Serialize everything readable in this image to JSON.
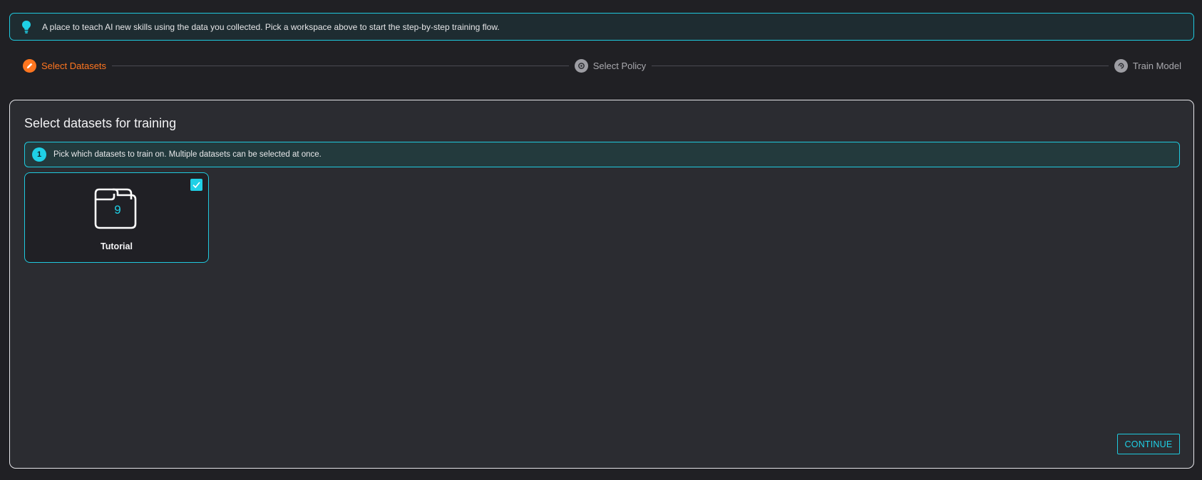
{
  "info_banner": {
    "icon": "lightbulb-icon",
    "text": "A place to teach AI new skills using the data you collected. Pick a workspace above to start the step-by-step training flow."
  },
  "stepper": {
    "steps": [
      {
        "label": "Select Datasets",
        "state": "active",
        "icon": "pencil-icon"
      },
      {
        "label": "Select Policy",
        "state": "inactive",
        "icon": "policy-icon"
      },
      {
        "label": "Train Model",
        "state": "inactive",
        "icon": "train-icon"
      }
    ]
  },
  "panel": {
    "title": "Select datasets for training",
    "hint": {
      "number": "1",
      "text": "Pick which datasets to train on. Multiple datasets can be selected at once."
    },
    "datasets": [
      {
        "name": "Tutorial",
        "count": "9",
        "selected": true
      }
    ],
    "continue_label": "CONTINUE"
  },
  "colors": {
    "accent": "#1fd0e6",
    "active_step": "#ff7620",
    "background": "#202024",
    "panel": "#2b2c31"
  }
}
